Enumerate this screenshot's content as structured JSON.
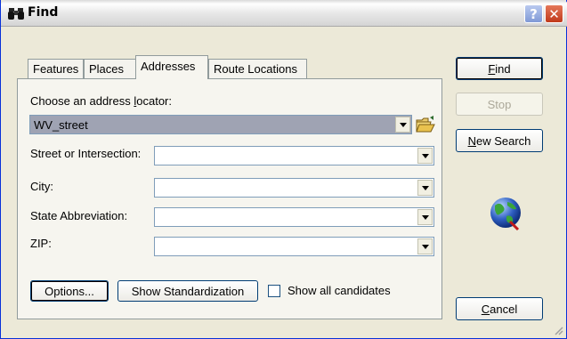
{
  "window": {
    "title": "Find",
    "help_button": "?",
    "close_button": "✕"
  },
  "tabs": [
    {
      "label": "Features"
    },
    {
      "label": "Places"
    },
    {
      "label": "Addresses"
    },
    {
      "label": "Route Locations"
    }
  ],
  "active_tab": "Addresses",
  "form": {
    "locator_label_pre": "Choose an address ",
    "locator_label_key": "l",
    "locator_label_post": "ocator:",
    "locator_value": "WV_street",
    "fields": [
      {
        "label": "Street or Intersection:",
        "value": ""
      },
      {
        "label": "City:",
        "value": ""
      },
      {
        "label": "State Abbreviation:",
        "value": ""
      },
      {
        "label": "ZIP:",
        "value": ""
      }
    ],
    "options_button": "Options...",
    "standardization_button": "Show Standardization",
    "show_all_label": "Show all candidates",
    "show_all_checked": false
  },
  "side_buttons": {
    "find_key": "F",
    "find_rest": "ind",
    "stop": "Stop",
    "new_search_key": "N",
    "new_search_rest": "ew Search",
    "cancel_key": "C",
    "cancel_rest": "ancel"
  },
  "icons": {
    "title": "binoculars-icon",
    "browse": "open-folder-icon",
    "globe": "globe-icon"
  }
}
